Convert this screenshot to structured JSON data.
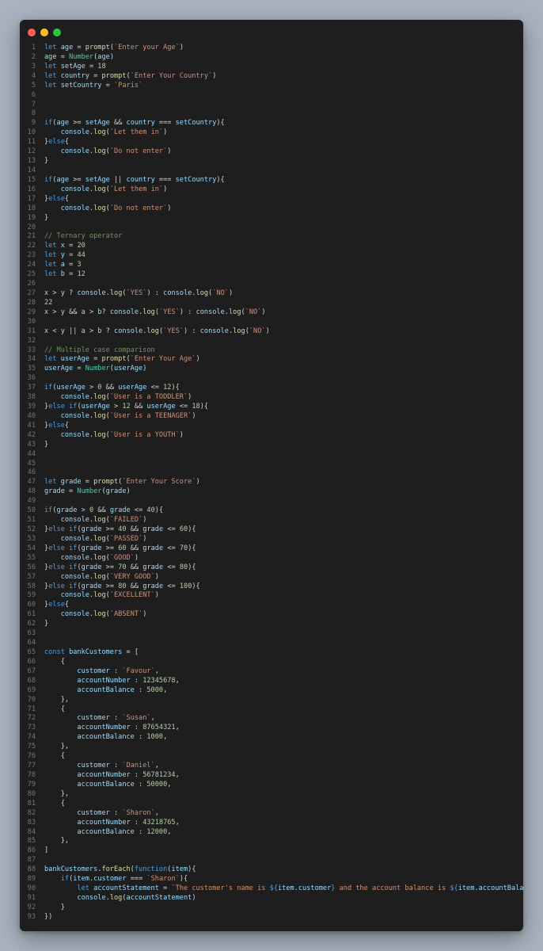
{
  "editor": {
    "colors": {
      "page_background": "#a9b3bf",
      "editor_background": "#1e1e1e",
      "close": "#ff5f57",
      "minimize": "#febc2e",
      "zoom": "#28c840"
    },
    "lines": [
      "let age = prompt(`Enter your Age`)",
      "age = Number(age)",
      "let setAge = 18",
      "let country = prompt(`Enter Your Country`)",
      "let setCountry = `Paris`",
      "",
      "",
      "",
      "if(age >= setAge && country === setCountry){",
      "    console.log(`Let them in`)",
      "}else{",
      "    console.log(`Do not enter`)",
      "}",
      "",
      "if(age >= setAge || country === setCountry){",
      "    console.log(`Let them in`)",
      "}else{",
      "    console.log(`Do not enter`)",
      "}",
      "",
      "// Ternary operator",
      "let x = 20",
      "let y = 44",
      "let a = 3",
      "let b = 12",
      "",
      "x > y ? console.log(`YES`) : console.log(`NO`)",
      "22",
      "x > y && a > b? console.log(`YES`) : console.log(`NO`)",
      "",
      "x < y || a > b ? console.log(`YES`) : console.log(`NO`)",
      "",
      "// Multiple case comparison",
      "let userAge = prompt(`Enter Your Age`)",
      "userAge = Number(userAge)",
      "",
      "if(userAge > 0 && userAge <= 12){",
      "    console.log(`User is a TODDLER`)",
      "}else if(userAge > 12 && userAge <= 18){",
      "    console.log(`User is a TEENAGER`)",
      "}else{",
      "    console.log(`User is a YOUTH`)",
      "}",
      "",
      "",
      "",
      "let grade = prompt(`Enter Your Score`)",
      "grade = Number(grade)",
      "",
      "if(grade > 0 && grade <= 40){",
      "    console.log(`FAILED`)",
      "}else if(grade >= 40 && grade <= 60){",
      "    console.log(`PASSED`)",
      "}else if(grade >= 60 && grade <= 70){",
      "    console.log(`GOOD`)",
      "}else if(grade >= 70 && grade <= 80){",
      "    console.log(`VERY GOOD`)",
      "}else if(grade >= 80 && grade <= 100){",
      "    console.log(`EXCELLENT`)",
      "}else{",
      "    console.log(`ABSENT`)",
      "}",
      "",
      "",
      "const bankCustomers = [",
      "    {",
      "        customer : `Favour`,",
      "        accountNumber : 12345678,",
      "        accountBalance : 5000,",
      "    },",
      "    {",
      "        customer : `Susan`,",
      "        accountNumber : 87654321,",
      "        accountBalance : 1000,",
      "    },",
      "    {",
      "        customer : `Daniel`,",
      "        accountNumber : 56781234,",
      "        accountBalance : 50000,",
      "    },",
      "    {",
      "        customer : `Sharon`,",
      "        accountNumber : 43218765,",
      "        accountBalance : 12000,",
      "    },",
      "]",
      "",
      "bankCustomers.forEach(function(item){",
      "    if(item.customer === `Sharon`){",
      "        let accountStatement = `The customer's name is ${item.customer} and the account balance is ${item.accountBalance}`",
      "        console.log(accountStatement)",
      "    }",
      "})"
    ]
  }
}
